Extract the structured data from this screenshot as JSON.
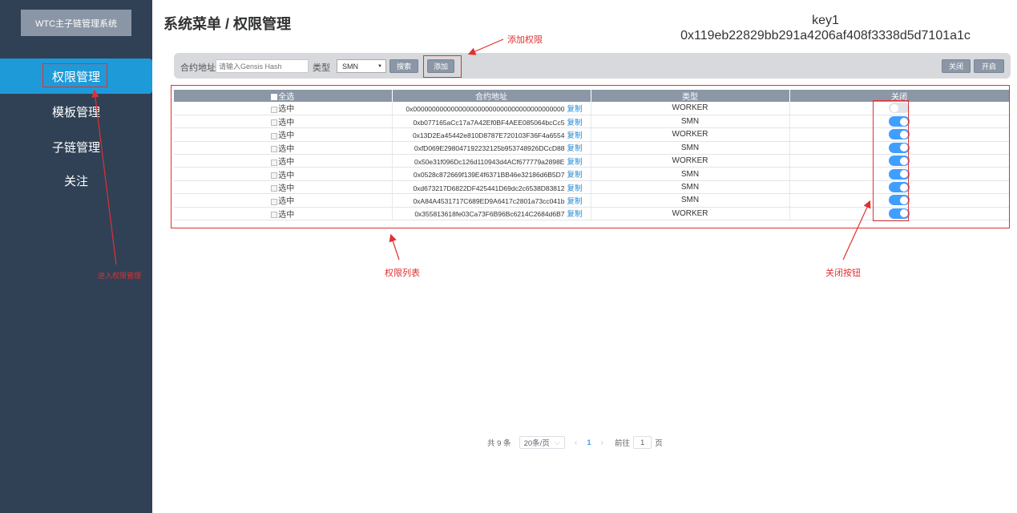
{
  "sidebar": {
    "logo": "WTC主子链管理系统",
    "items": [
      {
        "label": "权限管理"
      },
      {
        "label": "模板管理"
      },
      {
        "label": "子链管理"
      },
      {
        "label": "关注"
      }
    ]
  },
  "header": {
    "breadcrumb": "系统菜单 / 权限管理",
    "key_label": "key1",
    "key_value": "0x119eb22829bb291a4206af408f3338d5d7101a1c"
  },
  "toolbar": {
    "address_label": "合约地址:",
    "address_placeholder": "请输入Gensis Hash",
    "type_label": "类型",
    "type_selected": "SMN",
    "search_label": "搜索",
    "add_label": "添加",
    "close_label": "关闭",
    "open_label": "开启"
  },
  "table": {
    "headers": {
      "select_all": "全选",
      "address": "合约地址",
      "type": "类型",
      "close": "关闭"
    },
    "select_label": "选中",
    "copy_label": "复制",
    "rows": [
      {
        "address": "0x0000000000000000000000000000000000000000",
        "type": "WORKER",
        "enabled": false
      },
      {
        "address": "0xb077165aCc17a7A42Ef0BF4AEE085064bcCc5",
        "type": "SMN",
        "enabled": true
      },
      {
        "address": "0x13D2Ea45442e810D8787E720103F36F4a6554",
        "type": "WORKER",
        "enabled": true
      },
      {
        "address": "0xfD069E298047192232125b953748926DCcD88",
        "type": "SMN",
        "enabled": true
      },
      {
        "address": "0x50e31f096Dc126d110943d4ACf677779a2898E",
        "type": "WORKER",
        "enabled": true
      },
      {
        "address": "0x0528c872669f139E4f6371BB46e32186d6B5D7",
        "type": "SMN",
        "enabled": true
      },
      {
        "address": "0xd673217D6822DF425441D69dc2c6538D83812",
        "type": "SMN",
        "enabled": true
      },
      {
        "address": "0xA84A4531717C689ED9A6417c2801a73cc041b",
        "type": "SMN",
        "enabled": true
      },
      {
        "address": "0x355813618fe03Ca73F6B96Bc6214C2684d6B7",
        "type": "WORKER",
        "enabled": true
      }
    ]
  },
  "pagination": {
    "total": "共 9 条",
    "page_size": "20条/页",
    "current_page": "1",
    "goto_label": "前往",
    "goto_value": "1",
    "page_unit": "页"
  },
  "annotations": {
    "add_permission": "添加权限",
    "enter_permission": "进入权限管理",
    "permission_list": "权限列表",
    "close_button": "关闭按钮",
    "color": "#e03030"
  },
  "colors": {
    "sidebar_bg": "#304156",
    "active_item": "#1f9ad9",
    "switch_on": "#409eff",
    "header_row": "#8b97a7"
  }
}
